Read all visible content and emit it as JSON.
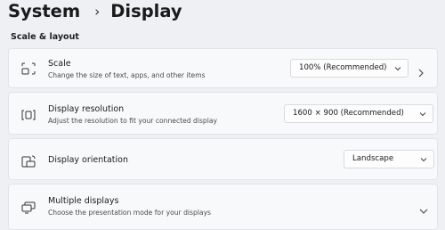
{
  "breadcrumb": {
    "root": "System",
    "separator": "›",
    "current": "Display"
  },
  "section": {
    "title": "Scale & layout"
  },
  "settings": {
    "scale": {
      "icon": "scale-icon",
      "title": "Scale",
      "description": "Change the size of text, apps, and other items",
      "value": "100% (Recommended)"
    },
    "resolution": {
      "icon": "resolution-icon",
      "title": "Display resolution",
      "description": "Adjust the resolution to fit your connected display",
      "value": "1600 × 900 (Recommended)"
    },
    "orientation": {
      "icon": "orientation-icon",
      "title": "Display orientation",
      "value": "Landscape"
    },
    "multiple_displays": {
      "icon": "multiple-displays-icon",
      "title": "Multiple displays",
      "description": "Choose the presentation mode for your displays"
    }
  }
}
